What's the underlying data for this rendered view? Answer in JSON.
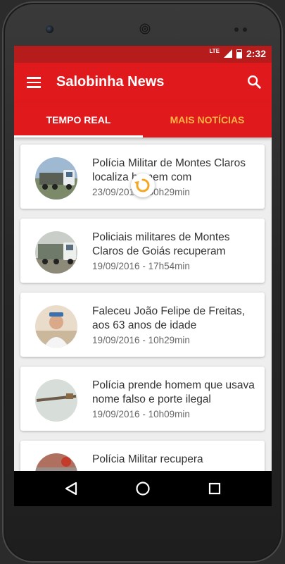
{
  "status_bar": {
    "network": "LTE",
    "time": "2:32"
  },
  "app_bar": {
    "title": "Salobinha News"
  },
  "tabs": [
    {
      "label": "TEMPO REAL",
      "active": true
    },
    {
      "label": "MAIS NOTÍCIAS",
      "active": false
    }
  ],
  "news": [
    {
      "title": "Polícia Militar de Montes Claros localiza homem com",
      "date": "23/09/2016 - 00h29min"
    },
    {
      "title": "Policiais militares de Montes Claros de Goiás recuperam",
      "date": "19/09/2016 - 17h54min"
    },
    {
      "title": "Faleceu João Felipe de Freitas, aos 63 anos de idade",
      "date": "19/09/2016 - 10h29min"
    },
    {
      "title": "Polícia prende homem que usava nome falso e porte ilegal",
      "date": "19/09/2016 - 10h09min"
    },
    {
      "title": "Polícia Militar recupera",
      "date": ""
    }
  ],
  "colors": {
    "primary": "#e0191c",
    "primary_dark": "#b71c1c",
    "tab_inactive": "#ffb347",
    "spinner": "#f5a623"
  },
  "icons": {
    "menu": "hamburger-icon",
    "search": "search-icon",
    "loading": "refresh-icon",
    "back": "back-icon",
    "home": "home-icon",
    "recents": "recents-icon"
  }
}
